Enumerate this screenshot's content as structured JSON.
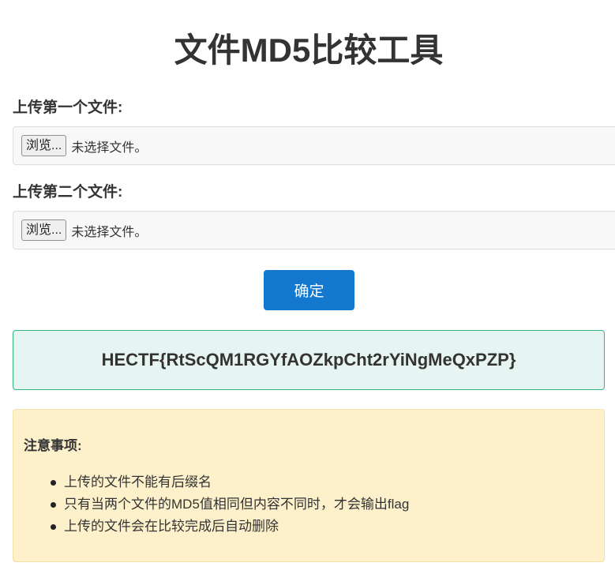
{
  "header": {
    "title": "文件MD5比较工具"
  },
  "upload": {
    "first": {
      "label": "上传第一个文件:",
      "browse_label": "浏览...",
      "status": "未选择文件。"
    },
    "second": {
      "label": "上传第二个文件:",
      "browse_label": "浏览...",
      "status": "未选择文件。"
    },
    "submit_label": "确定"
  },
  "result": {
    "flag": "HECTF{RtScQM1RGYfAOZkpCht2rYiNgMeQxPZP}"
  },
  "notice": {
    "title": "注意事项:",
    "items": [
      "上传的文件不能有后缀名",
      "只有当两个文件的MD5值相同但内容不同时，才会输出flag",
      "上传的文件会在比较完成后自动删除"
    ]
  },
  "colors": {
    "primary_button": "#1478cf",
    "result_background": "#e6f5f1",
    "result_border": "#34b27a",
    "notice_background": "#fdf1cc"
  }
}
